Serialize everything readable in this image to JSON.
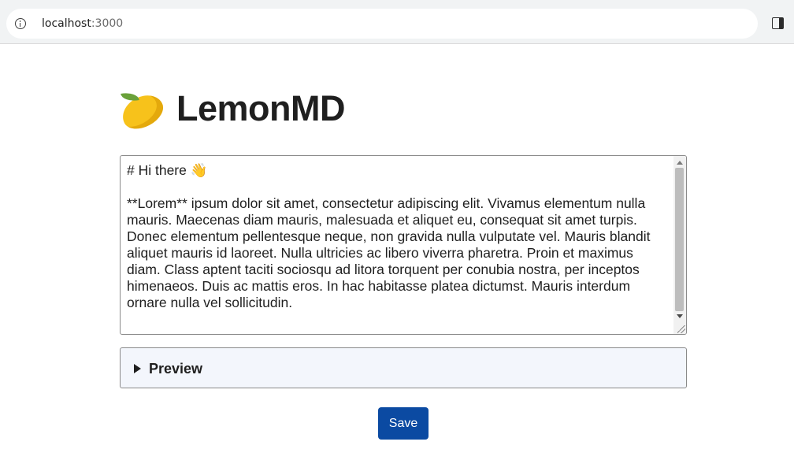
{
  "browser": {
    "url_host": "localhost",
    "url_port": ":3000",
    "info_icon": "info-icon",
    "side_panel_icon": "side-panel-icon"
  },
  "page": {
    "logo_icon": "lemon-icon",
    "title": "LemonMD"
  },
  "editor": {
    "value": "# Hi there 👋\n\n**Lorem** ipsum dolor sit amet, consectetur adipiscing elit. Vivamus elementum nulla mauris. Maecenas diam mauris, malesuada et aliquet eu, consequat sit amet turpis. Donec elementum pellentesque neque, non gravida nulla vulputate vel. Mauris blandit aliquet mauris id laoreet. Nulla ultricies ac libero viverra pharetra. Proin et maximus diam. Class aptent taciti sociosqu ad litora torquent per conubia nostra, per inceptos himenaeos. Duis ac mattis eros. In hac habitasse platea dictumst. Mauris interdum ornare nulla vel sollicitudin."
  },
  "preview": {
    "label": "Preview"
  },
  "actions": {
    "save_label": "Save",
    "save_color": "#0b4aa2"
  }
}
